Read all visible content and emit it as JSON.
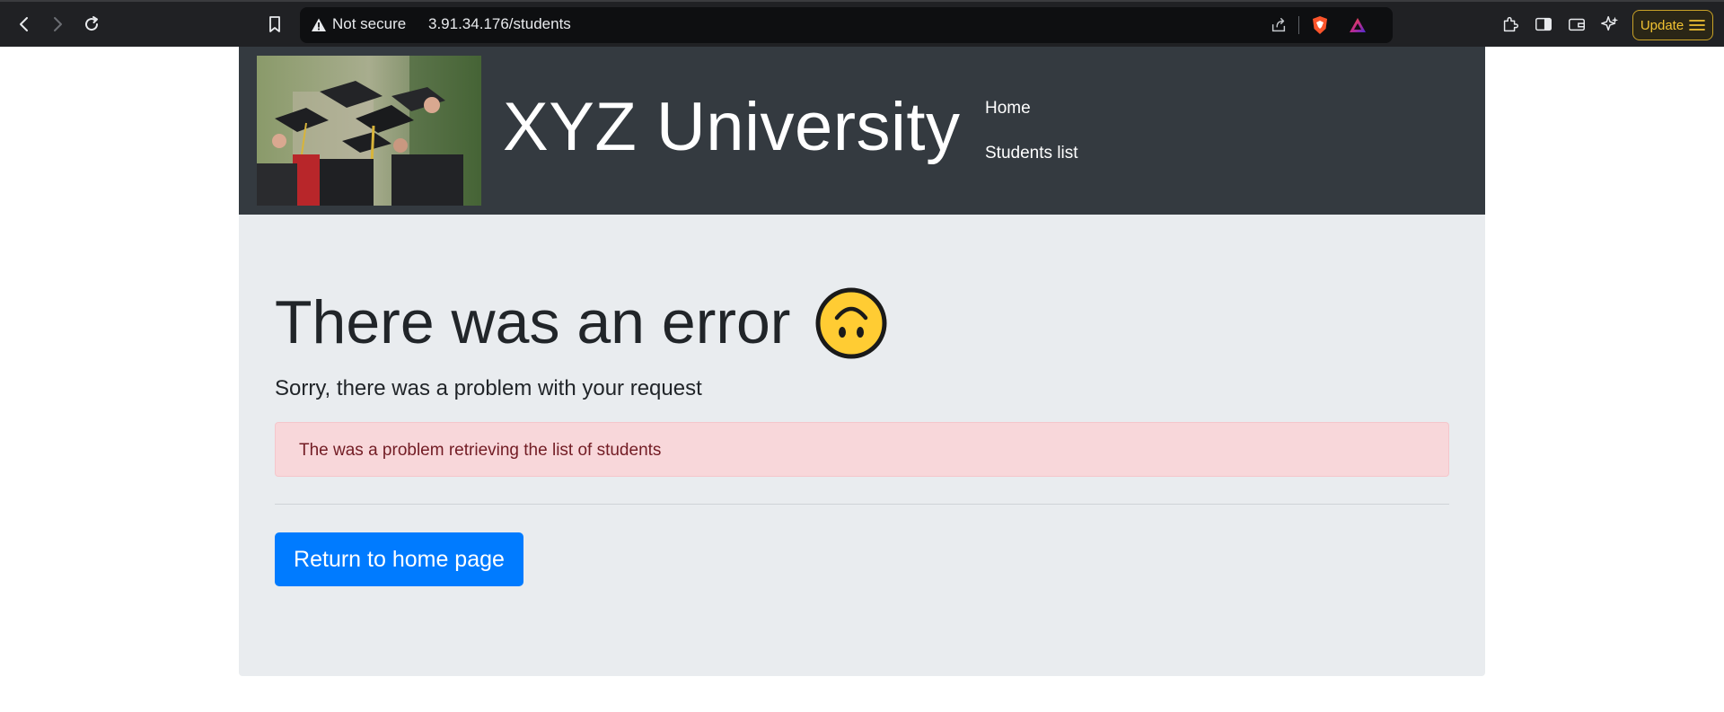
{
  "browser": {
    "security_label": "Not secure",
    "url": "3.91.34.176/students",
    "update_label": "Update",
    "icons": [
      "back-icon",
      "forward-icon",
      "reload-icon",
      "bookmark-icon",
      "warning-icon",
      "share-icon",
      "brave-shield-icon",
      "brave-rewards-icon",
      "extensions-icon",
      "sidebar-icon",
      "wallet-icon",
      "leo-ai-icon",
      "menu-icon"
    ]
  },
  "header": {
    "site_title": "XYZ University",
    "nav": [
      {
        "label": "Home"
      },
      {
        "label": "Students list"
      }
    ]
  },
  "main": {
    "error_title": "There was an error",
    "lead": "Sorry, there was a problem with your request",
    "alert_text": "The was a problem retrieving the list of students",
    "button_label": "Return to home page"
  },
  "colors": {
    "header_bg": "#343a40",
    "jumbotron_bg": "#e9ecef",
    "alert_bg": "#f8d7da",
    "alert_text": "#721c24",
    "primary": "#007bff",
    "update_accent": "#f1c232"
  }
}
